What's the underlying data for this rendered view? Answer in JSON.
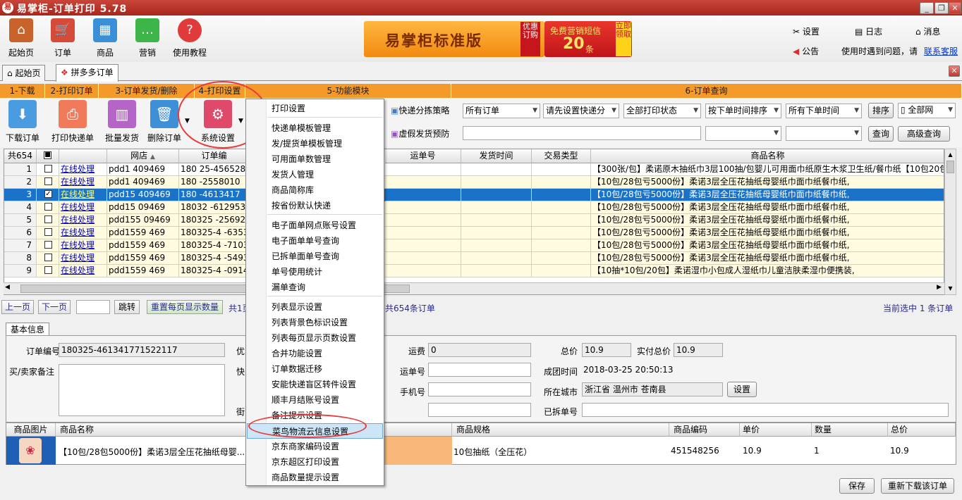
{
  "app": {
    "title": "易掌柜-订单打印 5.78",
    "logo": "易"
  },
  "toolbar": {
    "items": [
      {
        "label": "起始页",
        "icon": "home-icon",
        "color": "#c8642b"
      },
      {
        "label": "订单",
        "icon": "cart-icon",
        "color": "#d64a3a"
      },
      {
        "label": "商品",
        "icon": "shop-icon",
        "color": "#3a8fd6"
      },
      {
        "label": "营销",
        "icon": "chat-icon",
        "color": "#3db548"
      },
      {
        "label": "使用教程",
        "icon": "help-icon",
        "color": "#e03a3a"
      }
    ],
    "banner_title": "易掌柜标准版",
    "banner_badge": "优惠订购",
    "sms_title": "免费营销短信",
    "sms_count": "20",
    "sms_unit": "条",
    "sms_badge": "立即领取",
    "right": {
      "settings": "设置",
      "log": "日志",
      "message": "消息",
      "notice": "公告",
      "help_text": "使用时遇到问题，请",
      "contact": "联系客服"
    }
  },
  "tabs": [
    {
      "label": "起始页"
    },
    {
      "label": "拼多多订单"
    }
  ],
  "sections": [
    "1-下载",
    "2-打印订单",
    "3-订单发货/删除",
    "4-打印设置",
    "5-功能模块",
    "6-订单查询"
  ],
  "ops": {
    "download": "下载订单",
    "print_express": "打印快递单",
    "batch_ship": "批量发货",
    "delete": "删除订单",
    "settings": "系统设置",
    "strategy": "快递分拣策略",
    "fake_ship": "虚假发货预防",
    "selects": [
      "所有订单",
      "请先设置快递分",
      "全部打印状态",
      "按下单时间排序",
      "所有下单时间"
    ],
    "sort": "排序",
    "shop": "全部网",
    "query": "查询",
    "adv_query": "高级查询"
  },
  "grid": {
    "count_label": "共654",
    "headers": {
      "shop": "网店",
      "order": "订单编",
      "waybill": "运单号",
      "ship_time": "发货时间",
      "trade_type": "交易类型",
      "product": "商品名称"
    },
    "rows": [
      {
        "n": "1",
        "checked": false,
        "action": "在线处理",
        "shop": "pdd1 409469",
        "order": "180 25-4565282",
        "product": "【300张/包】柔诺原木抽纸巾3层100抽/包婴儿可用面巾纸原生木浆卫生纸/餐巾纸【10包20包"
      },
      {
        "n": "2",
        "checked": false,
        "action": "在线处理",
        "shop": "pdd1 409469",
        "order": "180  -2558010",
        "product": "【10包/28包亏5000份】柔诺3层全压花抽纸母婴纸巾面巾纸餐巾纸,"
      },
      {
        "n": "3",
        "checked": true,
        "action": "在线处理",
        "shop": "pdd15 409469",
        "order": "180  -4613417",
        "product": "【10包/28包亏5000份】柔诺3层全压花抽纸母婴纸巾面巾纸餐巾纸,"
      },
      {
        "n": "4",
        "checked": false,
        "action": "在线处理",
        "shop": "pdd15 09469",
        "order": "18032  -612953",
        "product": "【10包/28包亏5000份】柔诺3层全压花抽纸母婴纸巾面巾纸餐巾纸,"
      },
      {
        "n": "5",
        "checked": false,
        "action": "在线处理",
        "shop": "pdd155 09469",
        "order": "180325 -256924",
        "product": "【10包/28包亏5000份】柔诺3层全压花抽纸母婴纸巾面巾纸餐巾纸,"
      },
      {
        "n": "6",
        "checked": false,
        "action": "在线处理",
        "shop": "pdd1559 469",
        "order": "180325-4  -63535",
        "product": "【10包/28包亏5000份】柔诺3层全压花抽纸母婴纸巾面巾纸餐巾纸,"
      },
      {
        "n": "7",
        "checked": false,
        "action": "在线处理",
        "shop": "pdd1559 469",
        "order": "180325-4  -71033",
        "product": "【10包/28包亏5000份】柔诺3层全压花抽纸母婴纸巾面巾纸餐巾纸,"
      },
      {
        "n": "8",
        "checked": false,
        "action": "在线处理",
        "shop": "pdd1559 469",
        "order": "180325-4  -54939",
        "product": "【10包/28包亏5000份】柔诺3层全压花抽纸母婴纸巾面巾纸餐巾纸,"
      },
      {
        "n": "9",
        "checked": false,
        "action": "在线处理",
        "shop": "pdd1559 469",
        "order": "180325-4  -09147",
        "product": "【10抽*10包/20包】柔诺湿巾小包成人湿纸巾儿童洁肤柔湿巾便携装,"
      }
    ]
  },
  "pager": {
    "prev": "上一页",
    "next": "下一页",
    "goto": "跳转",
    "reset": "重置每页显示数量",
    "total_prefix": "共1页",
    "total": "共654条订单",
    "selected": "当前选中 1 条订单"
  },
  "detail": {
    "tab": "基本信息",
    "order_no_label": "订单编号",
    "order_no": "180325-461341771522117",
    "remark_label": "买/卖家备注",
    "discount_label": "优",
    "express_label": "快",
    "street_label": "街",
    "freight_label": "运费",
    "freight": "0",
    "total_label": "总价",
    "total": "10.9",
    "paid_label": "实付总价",
    "paid": "10.9",
    "waybill_label": "运单号",
    "group_time_label": "成团时间",
    "group_time": "2018-03-25 20:50:13",
    "phone_label": "手机号",
    "city_label": "所在城市",
    "city": "浙江省 温州市 苍南县",
    "city_btn": "设置",
    "split_label": "已拆单号"
  },
  "products": {
    "headers": {
      "image": "商品图片",
      "name": "商品名称",
      "spec": "商品规格",
      "code": "商品编码",
      "price": "单价",
      "qty": "数量",
      "total": "总价"
    },
    "row": {
      "name": "【10包/28包5000份】柔诺3层全压花抽纸母婴...",
      "spec": "10包抽纸（全压花）",
      "code": "451548256",
      "price": "10.9",
      "qty": "1",
      "total": "10.9"
    }
  },
  "footer": {
    "save": "保存",
    "redownload": "重新下载该订单"
  },
  "menu": {
    "groups": [
      [
        "打印设置"
      ],
      [
        "快递单模板管理",
        "发/提货单模板管理",
        "可用面单数管理",
        "发货人管理",
        "商品简称库",
        "按省份默认快递"
      ],
      [
        "电子面单网点账号设置",
        "电子面单单号查询",
        "已拆单面单号查询",
        "单号使用统计",
        "漏单查询"
      ],
      [
        "列表显示设置",
        "列表背景色标识设置",
        "列表每页显示页数设置",
        "合并功能设置",
        "订单数据迁移",
        "安能快递盲区转件设置",
        "顺丰月结账号设置",
        "备注提示设置",
        "菜鸟物流云信息设置",
        "京东商家编码设置",
        "京东超区打印设置",
        "商品数量提示设置"
      ]
    ]
  }
}
